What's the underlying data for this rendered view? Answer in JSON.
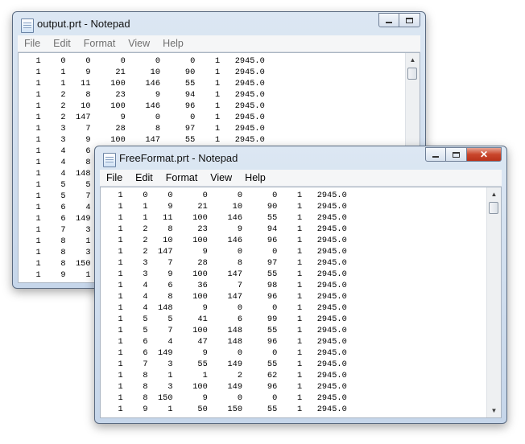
{
  "back_window": {
    "title": "output.prt - Notepad",
    "menu": [
      "File",
      "Edit",
      "Format",
      "View",
      "Help"
    ],
    "lines": [
      "   1    0    0      0      0      0    1   2945.0",
      "   1    1    9     21     10     90    1   2945.0",
      "   1    1   11    100    146     55    1   2945.0",
      "   1    2    8     23      9     94    1   2945.0",
      "   1    2   10    100    146     96    1   2945.0",
      "   1    2  147      9      0      0    1   2945.0",
      "   1    3    7     28      8     97    1   2945.0",
      "   1    3    9    100    147     55    1   2945.0",
      "   1    4    6",
      "   1    4    8",
      "   1    4  148",
      "   1    5    5",
      "   1    5    7",
      "   1    6    4",
      "   1    6  149",
      "   1    7    3",
      "   1    8    1",
      "   1    8    3",
      "   1    8  150",
      "   1    9    1"
    ],
    "scroll": {
      "up_icon": "arrow-up-icon",
      "down_icon": "arrow-down-icon"
    }
  },
  "front_window": {
    "title": "FreeFormat.prt - Notepad",
    "menu": [
      "File",
      "Edit",
      "Format",
      "View",
      "Help"
    ],
    "lines": [
      "   1    0    0      0      0      0    1   2945.0",
      "   1    1    9     21     10     90    1   2945.0",
      "   1    1   11    100    146     55    1   2945.0",
      "   1    2    8     23      9     94    1   2945.0",
      "   1    2   10    100    146     96    1   2945.0",
      "   1    2  147      9      0      0    1   2945.0",
      "   1    3    7     28      8     97    1   2945.0",
      "   1    3    9    100    147     55    1   2945.0",
      "   1    4    6     36      7     98    1   2945.0",
      "   1    4    8    100    147     96    1   2945.0",
      "   1    4  148      9      0      0    1   2945.0",
      "   1    5    5     41      6     99    1   2945.0",
      "   1    5    7    100    148     55    1   2945.0",
      "   1    6    4     47    148     96    1   2945.0",
      "   1    6  149      9      0      0    1   2945.0",
      "   1    7    3     55    149     55    1   2945.0",
      "   1    8    1      1      2     62    1   2945.0",
      "   1    8    3    100    149     96    1   2945.0",
      "   1    8  150      9      0      0    1   2945.0",
      "   1    9    1     50    150     55    1   2945.0"
    ],
    "caption": {
      "minimize_icon": "minimize-icon",
      "maximize_icon": "maximize-icon",
      "close_icon": "close-icon",
      "close_color": "#c9462c"
    }
  }
}
